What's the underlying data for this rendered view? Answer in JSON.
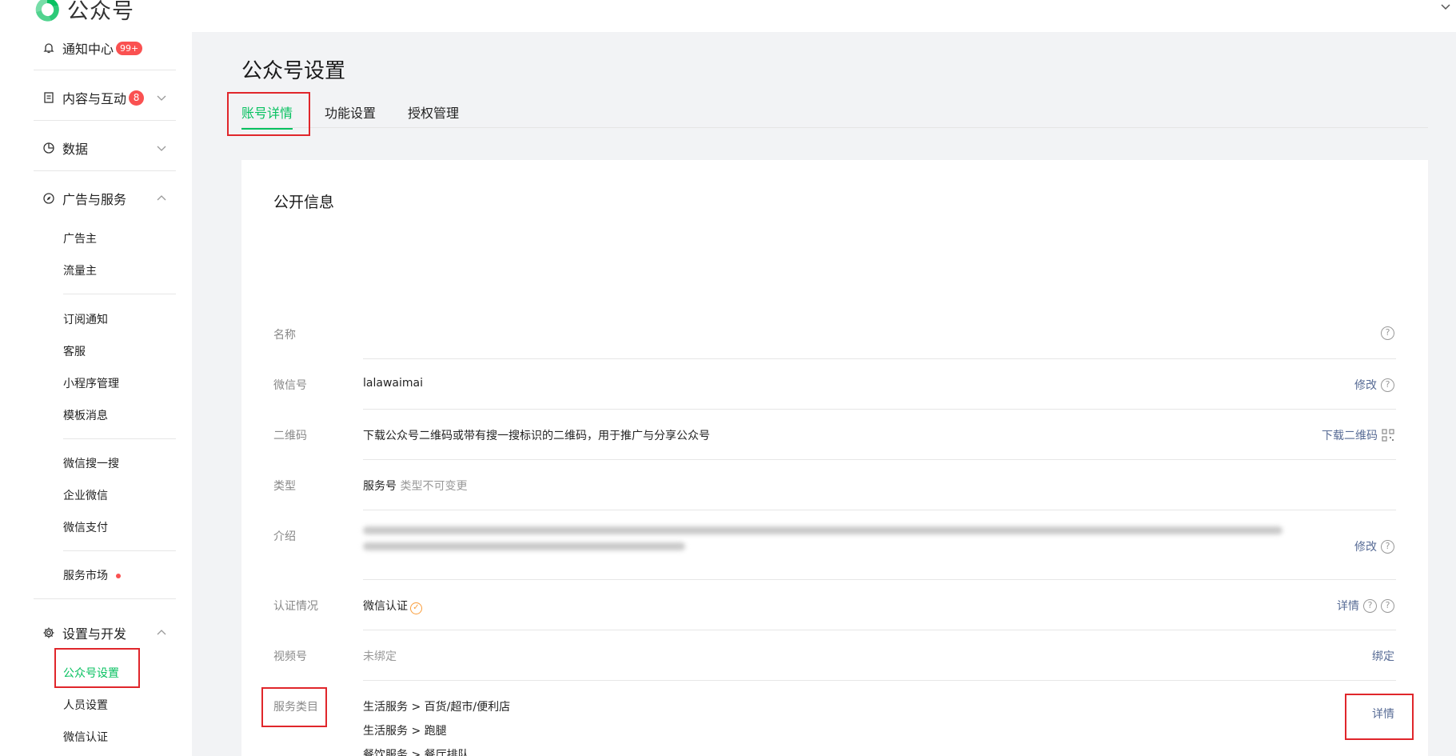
{
  "header": {
    "app_name": "公众号"
  },
  "sidebar": {
    "notice": {
      "label": "通知中心",
      "badge": "99+"
    },
    "content": {
      "label": "内容与互动",
      "badge": "8"
    },
    "data": {
      "label": "数据"
    },
    "ads": {
      "label": "广告与服务",
      "items": [
        "广告主",
        "流量主",
        "订阅通知",
        "客服",
        "小程序管理",
        "模板消息",
        "微信搜一搜",
        "企业微信",
        "微信支付",
        "服务市场"
      ]
    },
    "settings": {
      "label": "设置与开发",
      "items": [
        "公众号设置",
        "人员设置",
        "微信认证"
      ]
    }
  },
  "main": {
    "title": "公众号设置",
    "tabs": [
      "账号详情",
      "功能设置",
      "授权管理"
    ],
    "section_title": "公开信息",
    "rows": {
      "name": {
        "label": "名称"
      },
      "wechat_id": {
        "label": "微信号",
        "value": "lalawaimai",
        "action": "修改"
      },
      "qrcode": {
        "label": "二维码",
        "value": "下载公众号二维码或带有搜一搜标识的二维码，用于推广与分享公众号",
        "action": "下载二维码"
      },
      "type": {
        "label": "类型",
        "value": "服务号",
        "note": "类型不可变更"
      },
      "intro": {
        "label": "介绍",
        "action": "修改"
      },
      "verify": {
        "label": "认证情况",
        "value": "微信认证",
        "action": "详情"
      },
      "channels": {
        "label": "视频号",
        "value": "未绑定",
        "action": "绑定"
      },
      "category": {
        "label": "服务类目",
        "values": [
          "生活服务 > 百货/超市/便利店",
          "生活服务 > 跑腿",
          "餐饮服务 > 餐厅排队"
        ],
        "action": "详情"
      }
    }
  },
  "colors": {
    "accent": "#07c160",
    "link": "#576b95",
    "badge": "#fa5151",
    "annotation": "#e0262b"
  }
}
